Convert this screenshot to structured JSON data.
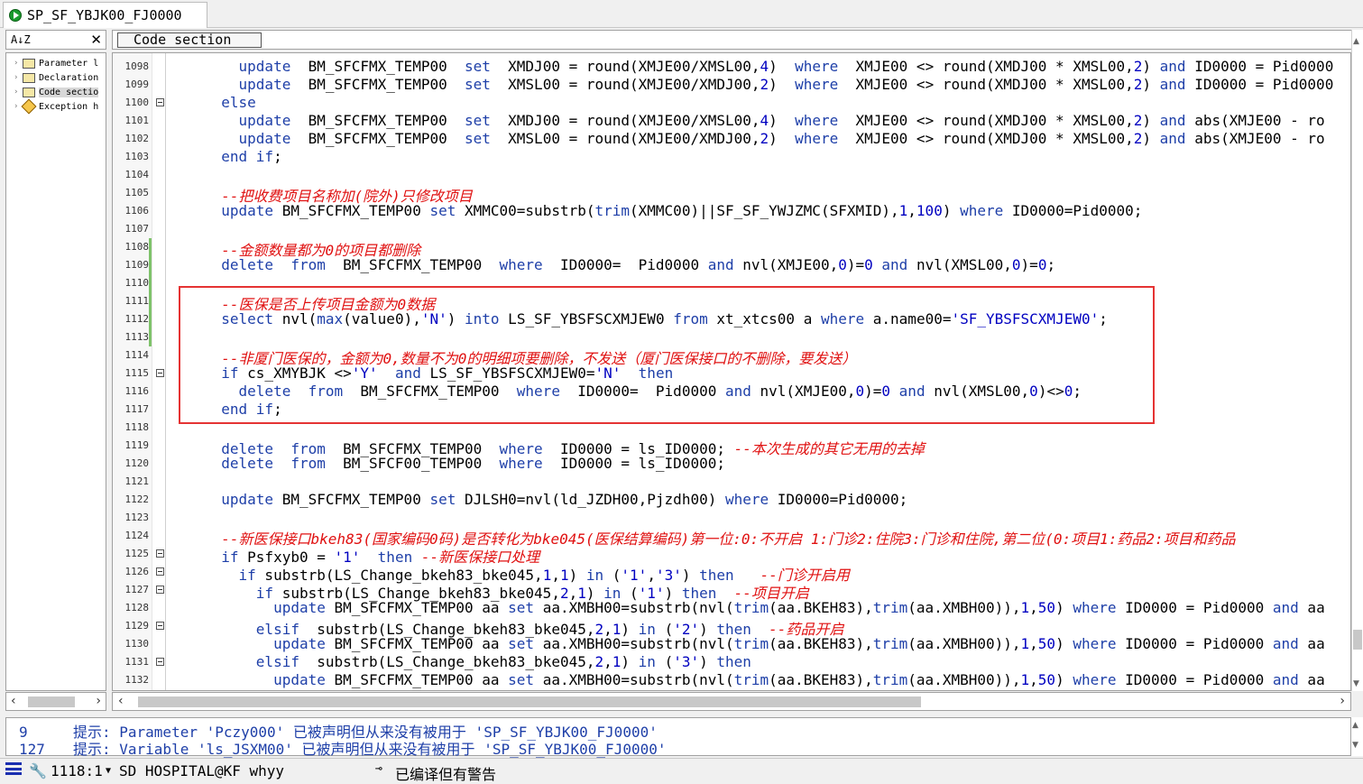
{
  "tab": {
    "title": "SP_SF_YBJK00_FJ0000"
  },
  "tree": {
    "sort_icon": "A↓Z",
    "close": "✕",
    "items": [
      {
        "label": "Parameter l",
        "icon": "folder-icon"
      },
      {
        "label": "Declaration",
        "icon": "folder-icon"
      },
      {
        "label": "Code sectio",
        "icon": "folder-icon"
      },
      {
        "label": "Exception h",
        "icon": "exception-icon"
      }
    ]
  },
  "section_dropdown": {
    "value": "Code section"
  },
  "editor": {
    "lines": [
      {
        "n": "1098",
        "fold": false,
        "html": "    <span class='k'>update</span>  BM_SFCFMX_TEMP00  <span class='k'>set</span>  XMDJ00 = round(XMJE00/XMSL00,<span class='n'>4</span>)  <span class='k'>where</span>  XMJE00 &lt;&gt; round(XMDJ00 * XMSL00,<span class='n'>2</span>) <span class='k'>and</span> ID0000 = Pid0000"
      },
      {
        "n": "1099",
        "fold": false,
        "html": "    <span class='k'>update</span>  BM_SFCFMX_TEMP00  <span class='k'>set</span>  XMSL00 = round(XMJE00/XMDJ00,<span class='n'>2</span>)  <span class='k'>where</span>  XMJE00 &lt;&gt; round(XMDJ00 * XMSL00,<span class='n'>2</span>) <span class='k'>and</span> ID0000 = Pid0000"
      },
      {
        "n": "1100",
        "fold": true,
        "html": "  <span class='k'>else</span>"
      },
      {
        "n": "1101",
        "fold": false,
        "html": "    <span class='k'>update</span>  BM_SFCFMX_TEMP00  <span class='k'>set</span>  XMDJ00 = round(XMJE00/XMSL00,<span class='n'>4</span>)  <span class='k'>where</span>  XMJE00 &lt;&gt; round(XMDJ00 * XMSL00,<span class='n'>2</span>) <span class='k'>and</span> abs(XMJE00 - ro"
      },
      {
        "n": "1102",
        "fold": false,
        "html": "    <span class='k'>update</span>  BM_SFCFMX_TEMP00  <span class='k'>set</span>  XMSL00 = round(XMJE00/XMDJ00,<span class='n'>2</span>)  <span class='k'>where</span>  XMJE00 &lt;&gt; round(XMDJ00 * XMSL00,<span class='n'>2</span>) <span class='k'>and</span> abs(XMJE00 - ro"
      },
      {
        "n": "1103",
        "fold": false,
        "html": "  <span class='k'>end if</span>;"
      },
      {
        "n": "1104",
        "fold": false,
        "html": ""
      },
      {
        "n": "1105",
        "fold": false,
        "html": "  <span class='c'>--把收费项目名称加(院外)只修改项目</span>"
      },
      {
        "n": "1106",
        "fold": false,
        "html": "  <span class='k'>update</span> BM_SFCFMX_TEMP00 <span class='k'>set</span> XMMC00=substrb(<span class='k'>trim</span>(XMMC00)||SF_SF_YWJZMC(SFXMID),<span class='n'>1</span>,<span class='n'>100</span>) <span class='k'>where</span> ID0000=Pid0000;"
      },
      {
        "n": "1107",
        "fold": false,
        "html": ""
      },
      {
        "n": "1108",
        "fold": false,
        "html": "  <span class='c'>--金额数量都为0的项目都删除</span>"
      },
      {
        "n": "1109",
        "fold": false,
        "html": "  <span class='k'>delete</span>  <span class='k'>from</span>  BM_SFCFMX_TEMP00  <span class='k'>where</span>  ID0000=  Pid0000 <span class='k'>and</span> nvl(XMJE00,<span class='n'>0</span>)=<span class='n'>0</span> <span class='k'>and</span> nvl(XMSL00,<span class='n'>0</span>)=<span class='n'>0</span>;"
      },
      {
        "n": "1110",
        "fold": false,
        "html": ""
      },
      {
        "n": "1111",
        "fold": false,
        "html": "  <span class='c'>--医保是否上传项目金额为0数据</span>"
      },
      {
        "n": "1112",
        "fold": false,
        "html": "  <span class='k'>select</span> nvl(<span class='k'>max</span>(value0),<span class='s'>'N'</span>) <span class='k'>into</span> LS_SF_YBSFSCXMJEW0 <span class='k'>from</span> xt_xtcs00 a <span class='k'>where</span> a.name00=<span class='s'>'SF_YBSFSCXMJEW0'</span>;"
      },
      {
        "n": "1113",
        "fold": false,
        "html": ""
      },
      {
        "n": "1114",
        "fold": false,
        "html": "  <span class='c'>--非厦门医保的，金额为0,数量不为0的明细项要删除，不发送（厦门医保接口的不删除，要发送）</span>"
      },
      {
        "n": "1115",
        "fold": true,
        "html": "  <span class='k'>if</span> cs_XMYBJK &lt;&gt;<span class='s'>'Y'</span>  <span class='k'>and</span> LS_SF_YBSFSCXMJEW0=<span class='s'>'N'</span>  <span class='k'>then</span>"
      },
      {
        "n": "1116",
        "fold": false,
        "html": "    <span class='k'>delete</span>  <span class='k'>from</span>  BM_SFCFMX_TEMP00  <span class='k'>where</span>  ID0000=  Pid0000 <span class='k'>and</span> nvl(XMJE00,<span class='n'>0</span>)=<span class='n'>0</span> <span class='k'>and</span> nvl(XMSL00,<span class='n'>0</span>)&lt;&gt;<span class='n'>0</span>;"
      },
      {
        "n": "1117",
        "fold": false,
        "html": "  <span class='k'>end if</span>;"
      },
      {
        "n": "1118",
        "fold": false,
        "html": ""
      },
      {
        "n": "1119",
        "fold": false,
        "html": "  <span class='k'>delete</span>  <span class='k'>from</span>  BM_SFCFMX_TEMP00  <span class='k'>where</span>  ID0000 = ls_ID0000; <span class='c'>--本次生成的其它无用的去掉</span>"
      },
      {
        "n": "1120",
        "fold": false,
        "html": "  <span class='k'>delete</span>  <span class='k'>from</span>  BM_SFCF00_TEMP00  <span class='k'>where</span>  ID0000 = ls_ID0000;"
      },
      {
        "n": "1121",
        "fold": false,
        "html": ""
      },
      {
        "n": "1122",
        "fold": false,
        "html": "  <span class='k'>update</span> BM_SFCFMX_TEMP00 <span class='k'>set</span> DJLSH0=nvl(ld_JZDH00,Pjzdh00) <span class='k'>where</span> ID0000=Pid0000;"
      },
      {
        "n": "1123",
        "fold": false,
        "html": ""
      },
      {
        "n": "1124",
        "fold": false,
        "html": "  <span class='c'>--新医保接口bkeh83(国家编码0码)是否转化为bke045(医保结算编码)第一位:0:不开启 1:门诊2:住院3:门诊和住院,第二位(0:项目1:药品2:项目和药品</span>"
      },
      {
        "n": "1125",
        "fold": true,
        "html": "  <span class='k'>if</span> Psfxyb0 = <span class='s'>'1'</span>  <span class='k'>then</span> <span class='c'>--新医保接口处理</span>"
      },
      {
        "n": "1126",
        "fold": true,
        "html": "    <span class='k'>if</span> substrb(LS_Change_bkeh83_bke045,<span class='n'>1</span>,<span class='n'>1</span>) <span class='k'>in</span> (<span class='s'>'1'</span>,<span class='s'>'3'</span>) <span class='k'>then</span>   <span class='c'>--门诊开启用</span>"
      },
      {
        "n": "1127",
        "fold": true,
        "html": "      <span class='k'>if</span> substrb(LS_Change_bkeh83_bke045,<span class='n'>2</span>,<span class='n'>1</span>) <span class='k'>in</span> (<span class='s'>'1'</span>) <span class='k'>then</span>  <span class='c'>--项目开启</span>"
      },
      {
        "n": "1128",
        "fold": false,
        "html": "        <span class='k'>update</span> BM_SFCFMX_TEMP00 aa <span class='k'>set</span> aa.XMBH00=substrb(nvl(<span class='k'>trim</span>(aa.BKEH83),<span class='k'>trim</span>(aa.XMBH00)),<span class='n'>1</span>,<span class='n'>50</span>) <span class='k'>where</span> ID0000 = Pid0000 <span class='k'>and</span> aa"
      },
      {
        "n": "1129",
        "fold": true,
        "html": "      <span class='k'>elsif</span>  substrb(LS_Change_bkeh83_bke045,<span class='n'>2</span>,<span class='n'>1</span>) <span class='k'>in</span> (<span class='s'>'2'</span>) <span class='k'>then</span>  <span class='c'>--药品开启</span>"
      },
      {
        "n": "1130",
        "fold": false,
        "html": "        <span class='k'>update</span> BM_SFCFMX_TEMP00 aa <span class='k'>set</span> aa.XMBH00=substrb(nvl(<span class='k'>trim</span>(aa.BKEH83),<span class='k'>trim</span>(aa.XMBH00)),<span class='n'>1</span>,<span class='n'>50</span>) <span class='k'>where</span> ID0000 = Pid0000 <span class='k'>and</span> aa"
      },
      {
        "n": "1131",
        "fold": true,
        "html": "      <span class='k'>elsif</span>  substrb(LS_Change_bkeh83_bke045,<span class='n'>2</span>,<span class='n'>1</span>) <span class='k'>in</span> (<span class='s'>'3'</span>) <span class='k'>then</span>"
      },
      {
        "n": "1132",
        "fold": false,
        "html": "        <span class='k'>update</span> BM_SFCFMX_TEMP00 aa <span class='k'>set</span> aa.XMBH00=substrb(nvl(<span class='k'>trim</span>(aa.BKEH83),<span class='k'>trim</span>(aa.XMBH00)),<span class='n'>1</span>,<span class='n'>50</span>) <span class='k'>where</span> ID0000 = Pid0000 <span class='k'>and</span> aa"
      }
    ]
  },
  "messages": [
    {
      "line": "9",
      "text": "提示: Parameter 'Pczy000' 已被声明但从来没有被用于 'SP_SF_YBJK00_FJ0000'"
    },
    {
      "line": "127",
      "text": "提示: Variable 'ls_JSXM00' 已被声明但从来没有被用于 'SP_SF_YBJK00_FJ0000'"
    }
  ],
  "status": {
    "position": "1118:1",
    "connection": "SD HOSPITAL@KF whyy",
    "compile_state": "已编译但有警告"
  },
  "colors": {
    "keyword": "#1e3fa8",
    "comment": "#e01010",
    "highlight_box": "#e53333",
    "change_bar": "#7ec26a"
  }
}
